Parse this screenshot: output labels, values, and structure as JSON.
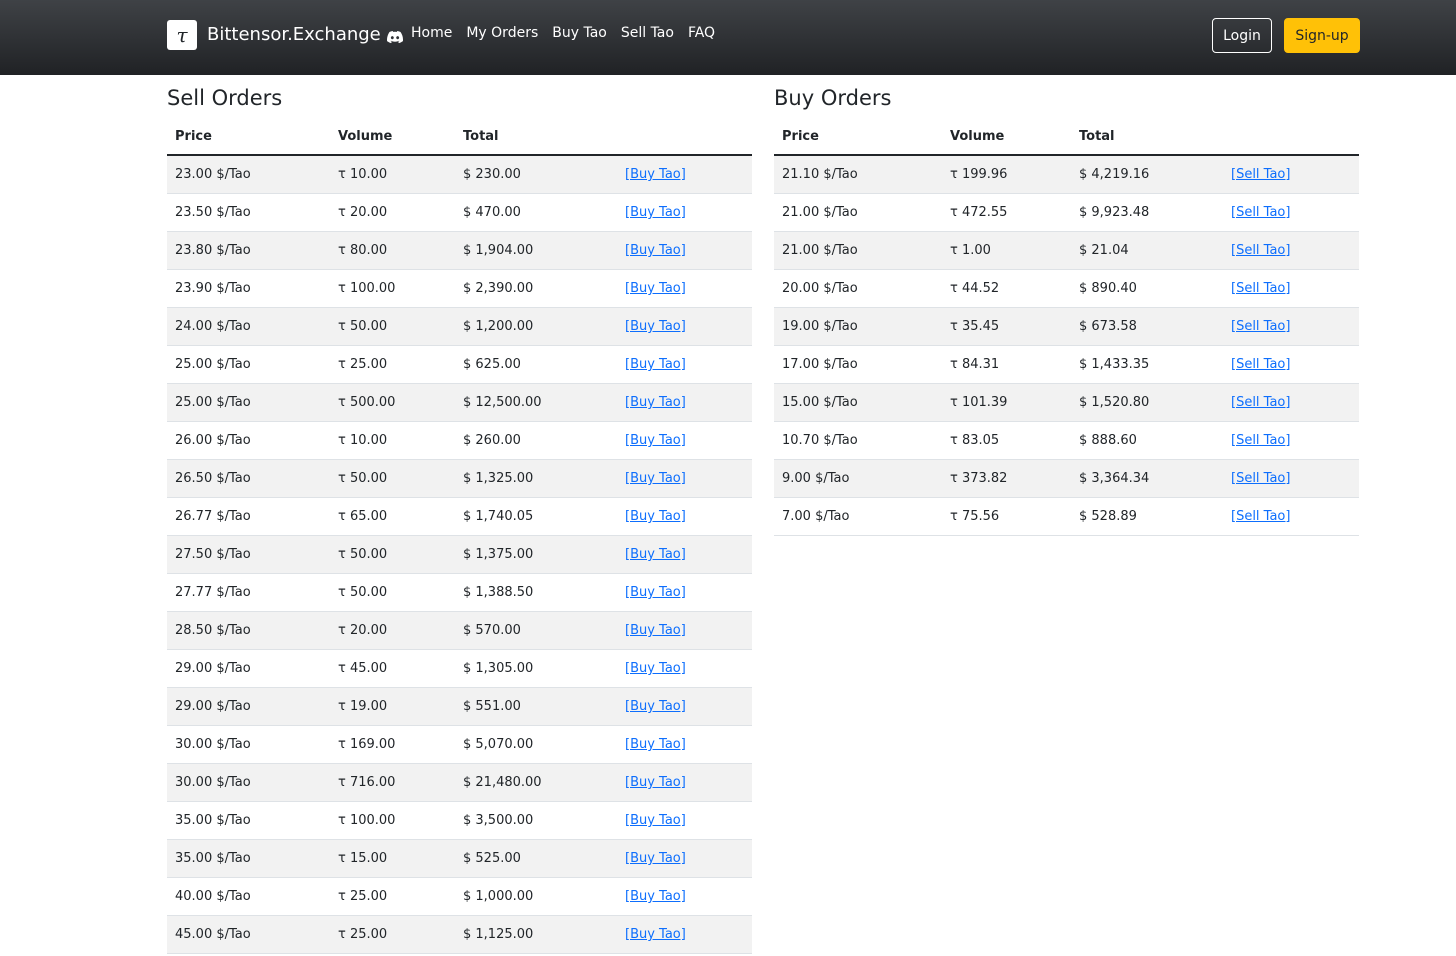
{
  "navbar": {
    "logo_glyph": "τ",
    "brand": "Bittensor.Exchange",
    "brand_icon": "discord-icon",
    "links": [
      "Home",
      "My Orders",
      "Buy Tao",
      "Sell Tao",
      "FAQ"
    ],
    "login_label": "Login",
    "signup_label": "Sign-up",
    "colors": {
      "bar": "#2b2d30",
      "signup": "#ffc107",
      "link": "#0d6efd"
    }
  },
  "sell": {
    "title": "Sell Orders",
    "headers": [
      "Price",
      "Volume",
      "Total",
      ""
    ],
    "rows": [
      [
        "23.00 $/Tao",
        "τ 10.00",
        "$ 230.00",
        "[Buy Tao]"
      ],
      [
        "23.50 $/Tao",
        "τ 20.00",
        "$ 470.00",
        "[Buy Tao]"
      ],
      [
        "23.80 $/Tao",
        "τ 80.00",
        "$ 1,904.00",
        "[Buy Tao]"
      ],
      [
        "23.90 $/Tao",
        "τ 100.00",
        "$ 2,390.00",
        "[Buy Tao]"
      ],
      [
        "24.00 $/Tao",
        "τ 50.00",
        "$ 1,200.00",
        "[Buy Tao]"
      ],
      [
        "25.00 $/Tao",
        "τ 25.00",
        "$ 625.00",
        "[Buy Tao]"
      ],
      [
        "25.00 $/Tao",
        "τ 500.00",
        "$ 12,500.00",
        "[Buy Tao]"
      ],
      [
        "26.00 $/Tao",
        "τ 10.00",
        "$ 260.00",
        "[Buy Tao]"
      ],
      [
        "26.50 $/Tao",
        "τ 50.00",
        "$ 1,325.00",
        "[Buy Tao]"
      ],
      [
        "26.77 $/Tao",
        "τ 65.00",
        "$ 1,740.05",
        "[Buy Tao]"
      ],
      [
        "27.50 $/Tao",
        "τ 50.00",
        "$ 1,375.00",
        "[Buy Tao]"
      ],
      [
        "27.77 $/Tao",
        "τ 50.00",
        "$ 1,388.50",
        "[Buy Tao]"
      ],
      [
        "28.50 $/Tao",
        "τ 20.00",
        "$ 570.00",
        "[Buy Tao]"
      ],
      [
        "29.00 $/Tao",
        "τ 45.00",
        "$ 1,305.00",
        "[Buy Tao]"
      ],
      [
        "29.00 $/Tao",
        "τ 19.00",
        "$ 551.00",
        "[Buy Tao]"
      ],
      [
        "30.00 $/Tao",
        "τ 169.00",
        "$ 5,070.00",
        "[Buy Tao]"
      ],
      [
        "30.00 $/Tao",
        "τ 716.00",
        "$ 21,480.00",
        "[Buy Tao]"
      ],
      [
        "35.00 $/Tao",
        "τ 100.00",
        "$ 3,500.00",
        "[Buy Tao]"
      ],
      [
        "35.00 $/Tao",
        "τ 15.00",
        "$ 525.00",
        "[Buy Tao]"
      ],
      [
        "40.00 $/Tao",
        "τ 25.00",
        "$ 1,000.00",
        "[Buy Tao]"
      ],
      [
        "45.00 $/Tao",
        "τ 25.00",
        "$ 1,125.00",
        "[Buy Tao]"
      ]
    ]
  },
  "buy": {
    "title": "Buy Orders",
    "headers": [
      "Price",
      "Volume",
      "Total",
      ""
    ],
    "rows": [
      [
        "21.10 $/Tao",
        "τ 199.96",
        "$ 4,219.16",
        "[Sell Tao]"
      ],
      [
        "21.00 $/Tao",
        "τ 472.55",
        "$ 9,923.48",
        "[Sell Tao]"
      ],
      [
        "21.00 $/Tao",
        "τ 1.00",
        "$ 21.04",
        "[Sell Tao]"
      ],
      [
        "20.00 $/Tao",
        "τ 44.52",
        "$ 890.40",
        "[Sell Tao]"
      ],
      [
        "19.00 $/Tao",
        "τ 35.45",
        "$ 673.58",
        "[Sell Tao]"
      ],
      [
        "17.00 $/Tao",
        "τ 84.31",
        "$ 1,433.35",
        "[Sell Tao]"
      ],
      [
        "15.00 $/Tao",
        "τ 101.39",
        "$ 1,520.80",
        "[Sell Tao]"
      ],
      [
        "10.70 $/Tao",
        "τ 83.05",
        "$ 888.60",
        "[Sell Tao]"
      ],
      [
        "9.00 $/Tao",
        "τ 373.82",
        "$ 3,364.34",
        "[Sell Tao]"
      ],
      [
        "7.00 $/Tao",
        "τ 75.56",
        "$ 528.89",
        "[Sell Tao]"
      ]
    ]
  }
}
